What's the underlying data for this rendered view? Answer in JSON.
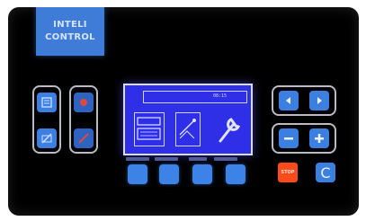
{
  "brand": {
    "line1": "INTELI",
    "line2": "CONTROL"
  },
  "display": {
    "time": "08:15"
  },
  "buttons": {
    "stop_label": "STOP",
    "reset_label": "C"
  },
  "colors": {
    "panel": "#000000",
    "brand": "#3f7cd8",
    "screen": "#2f2fe8",
    "button_blue": "#3b7fe0",
    "stop_red": "#ff4a1a"
  },
  "icons": {
    "left_group": [
      "document-icon",
      "emergency-red-icon",
      "disabled-icon",
      "disabled-red-icon"
    ],
    "screen": [
      "keyboard-display-icon",
      "calibrate-icon",
      "wrench-icon"
    ],
    "right_group": [
      "arrow-left-icon",
      "arrow-right-icon",
      "minus-icon",
      "plus-icon"
    ]
  }
}
